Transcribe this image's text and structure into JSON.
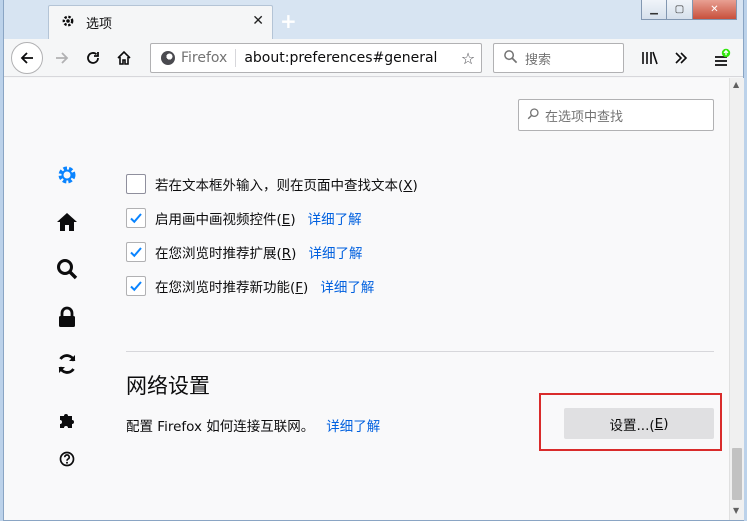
{
  "tab": {
    "title": "选项",
    "icon": "gear-icon"
  },
  "window_controls": {
    "minimize": "minimize-icon",
    "maximize": "maximize-icon",
    "close": "close-icon"
  },
  "navbar": {
    "identity_label": "Firefox",
    "url": "about:preferences#general",
    "search_placeholder": "搜索"
  },
  "find_in_options": {
    "placeholder": "在选项中查找"
  },
  "sidebar": {
    "items": [
      {
        "name": "general",
        "icon": "gear-icon",
        "active": true
      },
      {
        "name": "home",
        "icon": "home-icon"
      },
      {
        "name": "search",
        "icon": "search-icon"
      },
      {
        "name": "privacy",
        "icon": "lock-icon"
      },
      {
        "name": "sync",
        "icon": "sync-icon"
      },
      {
        "name": "extensions",
        "icon": "puzzle-icon"
      },
      {
        "name": "support",
        "icon": "help-icon"
      }
    ]
  },
  "options": [
    {
      "label": "若在文本框外输入，则在页面中查找文本(",
      "accesskey": "X",
      "suffix": ")",
      "checked": false,
      "link": ""
    },
    {
      "label": "启用画中画视频控件(",
      "accesskey": "E",
      "suffix": ")",
      "checked": true,
      "link": "详细了解"
    },
    {
      "label": "在您浏览时推荐扩展(",
      "accesskey": "R",
      "suffix": ")",
      "checked": true,
      "link": "详细了解"
    },
    {
      "label": "在您浏览时推荐新功能(",
      "accesskey": "F",
      "suffix": ")",
      "checked": true,
      "link": "详细了解"
    }
  ],
  "network": {
    "title": "网络设置",
    "description": "配置 Firefox 如何连接互联网。",
    "link": "详细了解",
    "button_label": "设置...(",
    "button_accesskey": "E",
    "button_suffix": ")"
  },
  "colors": {
    "accent": "#0a84ff",
    "link": "#0060df",
    "highlight": "#d92b2b"
  }
}
